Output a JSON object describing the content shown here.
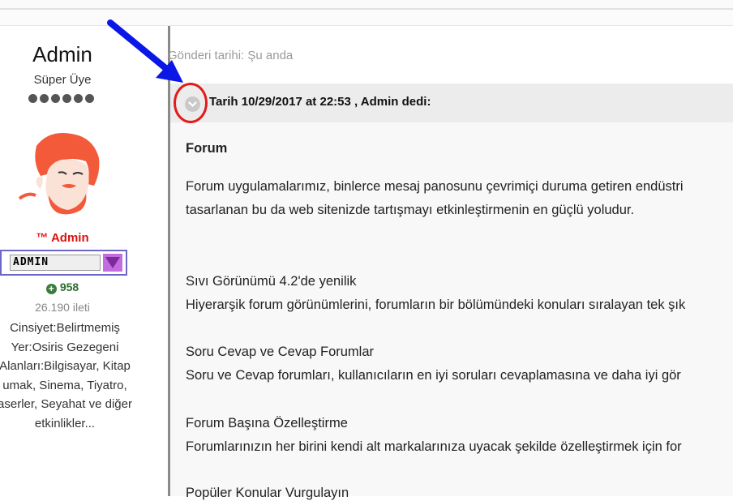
{
  "user": {
    "name": "Admin",
    "title": "Süper Üye",
    "rank": "™ Admin",
    "badge_text": "ADMIN",
    "reputation": "958",
    "posts": "26.190 ileti",
    "info": [
      "Cinsiyet:Belirtmemiş",
      "Yer:Osiris Gezegeni",
      "Alanları:Bilgisayar, Kitap",
      "umak, Sinema, Tiyatro,",
      "aserler, Seyahat ve diğer",
      "etkinlikler..."
    ]
  },
  "post": {
    "date_label": "Gönderi tarihi: Şu anda"
  },
  "quote": {
    "author_line": "Tarih 10/29/2017 at 22:53 , Admin dedi:",
    "heading": "Forum",
    "intro_1": "Forum uygulamalarımız, binlerce mesaj panosunu çevrimiçi duruma getiren endüstri",
    "intro_2": "tasarlanan bu da web sitenizde tartışmayı etkinleştirmenin en güçlü yoludur.",
    "sections": [
      {
        "title": "Sıvı Görünümü 4.2'de yenilik",
        "text": "Hiyerarşik forum görünümlerini, forumların bir bölümündeki konuları sıralayan tek şık"
      },
      {
        "title": "Soru Cevap ve Cevap Forumlar",
        "text": "Soru ve Cevap forumları, kullanıcıların en iyi soruları cevaplamasına ve daha iyi gör"
      },
      {
        "title": "Forum Başına Özelleştirme",
        "text": "Forumlarınızın her birini kendi alt markalarınıza uyacak şekilde özelleştirmek için for"
      },
      {
        "title": "Popüler Konular Vurgulayın",
        "text": ""
      }
    ]
  },
  "colors": {
    "annotation_arrow": "#0a17e6",
    "annotation_ring": "#e21b1b",
    "rank": "#dd1111",
    "reputation": "#2e6b2e"
  }
}
